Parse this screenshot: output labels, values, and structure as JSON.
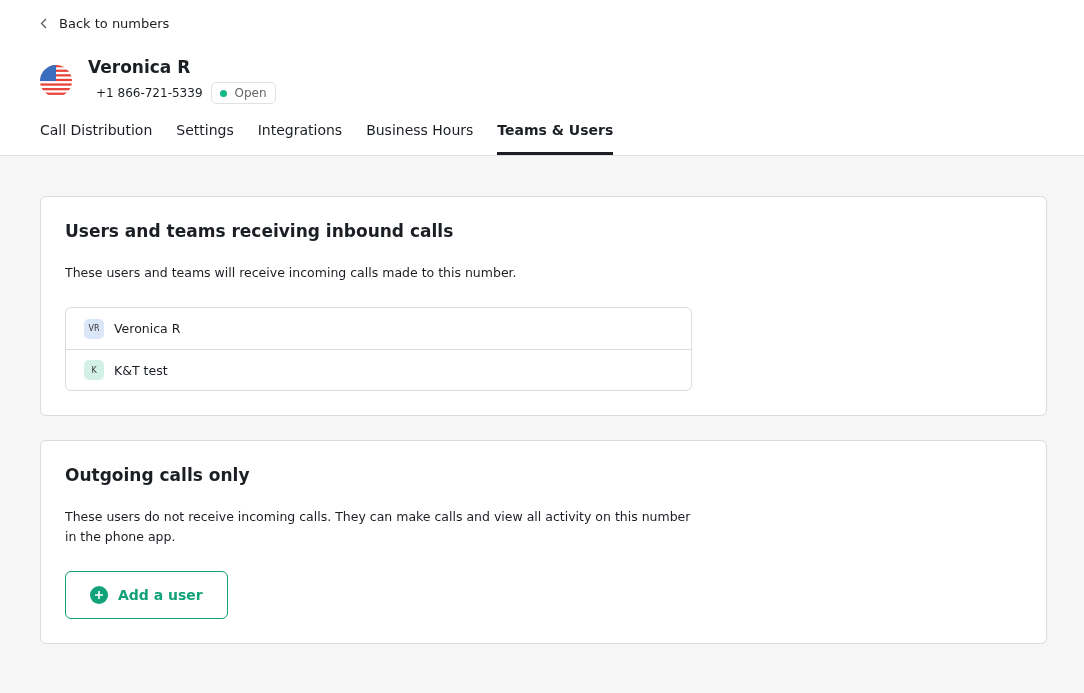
{
  "back_link": "Back to numbers",
  "number": {
    "name": "Veronica R",
    "phone": "+1 866-721-5339",
    "status": {
      "label": "Open",
      "color": "#12b886"
    }
  },
  "tabs": [
    {
      "label": "Call Distribution",
      "selected": false
    },
    {
      "label": "Settings",
      "selected": false
    },
    {
      "label": "Integrations",
      "selected": false
    },
    {
      "label": "Business Hours",
      "selected": false
    },
    {
      "label": "Teams & Users",
      "selected": true
    }
  ],
  "inbound": {
    "title": "Users and teams receiving inbound calls",
    "description": "These users and teams will receive incoming calls made to this number.",
    "members": [
      {
        "initials": "VR",
        "name": "Veronica R",
        "color": "#dce6f9"
      },
      {
        "initials": "K",
        "name": "K&T test",
        "color": "#d3f0e6"
      }
    ]
  },
  "outgoing": {
    "title": "Outgoing calls only",
    "description": "These users do not receive incoming calls. They can make calls and view all activity on this number in the phone app.",
    "button": "Add a user"
  }
}
